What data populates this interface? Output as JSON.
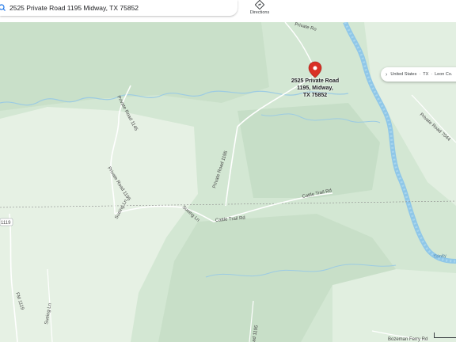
{
  "search": {
    "query": "2525 Private Road 1195 Midway, TX 75852"
  },
  "toolbar": {
    "directions_label": "Directions"
  },
  "breadcrumb": {
    "items": [
      "United States",
      "TX",
      "Leon Co."
    ]
  },
  "pin": {
    "line1": "2525 Private Road",
    "line2": "1195, Midway,",
    "line3": "TX 75852",
    "color": "#d93025"
  },
  "roads": {
    "private_road_1145": "Private Road 1145",
    "private_road_1195_left": "Private Road 1195",
    "private_road_1195_center": "Private Road 1195",
    "private_road_1195_top": "Private Ro",
    "private_road_7044": "Private Road 7044",
    "sueing_ln_1": "Sueing Ln",
    "sueing_ln_2": "Sueing Ln",
    "sueing_ln_3": "Sueing Ln",
    "cattle_trail_rd_1": "Cattle Trail Rd",
    "cattle_trail_rd_2": "Cattle Trail Rd",
    "fm_1119_badge": "1119",
    "fm_1119": "FM 1119",
    "bozeman_ferry_rd": "Bozeman Ferry Rd",
    "trinity": "Trinity",
    "partial_bottom": "ad 1195"
  },
  "colors": {
    "land_light": "#e4f0e2",
    "land_green": "#cfe5cf",
    "forest_dark": "#c2dcc3",
    "river": "#8fc7e8",
    "road": "#ffffff",
    "pin": "#d93025"
  }
}
